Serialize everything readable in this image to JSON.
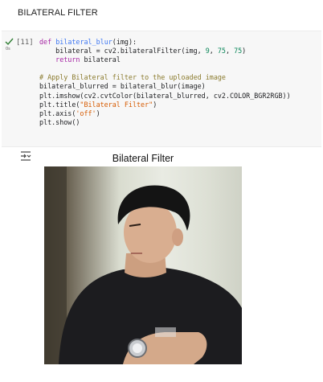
{
  "section": {
    "heading": "BILATERAL FILTER"
  },
  "cell": {
    "exec_count": "[11]",
    "code_lines": [
      "def bilateral_blur(img):",
      "    bilateral = cv2.bilateralFilter(img, 9, 75, 75)",
      "    return bilateral",
      "",
      "# Apply Bilateral filter to the uploaded image",
      "bilateral_blurred = bilateral_blur(image)",
      "plt.imshow(cv2.cvtColor(bilateral_blurred, cv2.COLOR_BGR2RGB))",
      "plt.title(\"Bilateral Filter\")",
      "plt.axis('off')",
      "plt.show()"
    ]
  },
  "output": {
    "plot_title": "Bilateral Filter",
    "image_description": "photo"
  },
  "colors": {
    "keyword": "#a626a4",
    "function": "#4078f2",
    "string": "#d65a00",
    "number": "#098658",
    "comment": "#8a7a2c",
    "run_check": "#2e7d32"
  },
  "icons": {
    "status": "check-icon",
    "output": "output-toggle-icon"
  }
}
